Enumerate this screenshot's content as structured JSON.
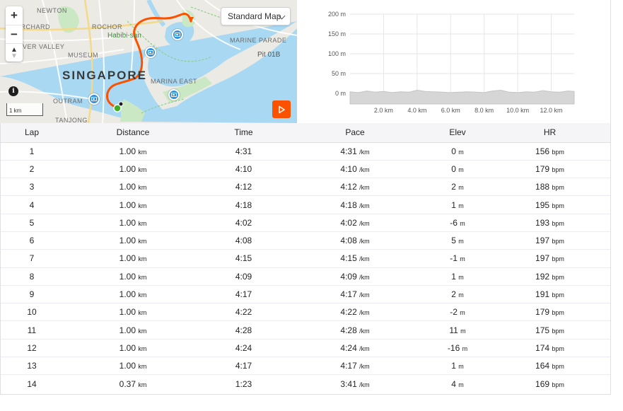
{
  "map": {
    "style_selector": "Standard Map",
    "zoom_in": "+",
    "zoom_out": "−",
    "scale_label": "1 km",
    "info": "i",
    "labels": {
      "newton": "NEWTON",
      "orchard": "ORCHARD",
      "rochor": "ROCHOR",
      "river_valley": "RIVER VALLEY",
      "museum": "MUSEUM",
      "singapore": "SINGAPORE",
      "habibi": "Habibi-san",
      "marine_parade": "MARINE PARADE",
      "pit": "Pit 01B",
      "marina_east": "MARINA EAST",
      "outram": "OUTRAM",
      "tanjong": "TANJONG"
    },
    "colors": {
      "route": "#fc5200",
      "water": "#a9d8f2",
      "park": "#c9e8c3",
      "start": "#3fae22",
      "photo": "#2f8fe0"
    }
  },
  "chart_data": {
    "type": "area",
    "title": "",
    "xlabel": "",
    "ylabel": "",
    "x_unit": "km",
    "y_unit": "m",
    "xlim": [
      0,
      13.37
    ],
    "ylim": [
      0,
      200
    ],
    "x_ticks": [
      "2.0 km",
      "4.0 km",
      "6.0 km",
      "8.0 km",
      "10.0 km",
      "12.0 km"
    ],
    "y_ticks": [
      "200 m",
      "150 m",
      "100 m",
      "50 m",
      "0 m"
    ],
    "grid": true,
    "x": [
      0,
      0.5,
      1.0,
      1.5,
      2.0,
      2.5,
      3.0,
      3.5,
      4.0,
      4.5,
      5.0,
      5.5,
      6.0,
      6.5,
      7.0,
      7.5,
      8.0,
      8.5,
      9.0,
      9.5,
      10.0,
      10.5,
      11.0,
      11.5,
      12.0,
      12.5,
      13.0,
      13.37
    ],
    "y": [
      4,
      2,
      6,
      3,
      5,
      2,
      4,
      3,
      8,
      5,
      4,
      3,
      2,
      3,
      4,
      3,
      2,
      6,
      8,
      3,
      2,
      4,
      3,
      7,
      4,
      3,
      6,
      5
    ],
    "fill_color": "#d6d6d6"
  },
  "table": {
    "headers": {
      "lap": "Lap",
      "distance": "Distance",
      "time": "Time",
      "pace": "Pace",
      "elev": "Elev",
      "hr": "HR"
    },
    "rows": [
      {
        "lap": "1",
        "distance": "1.00",
        "distance_unit": "km",
        "time": "4:31",
        "pace": "4:31",
        "pace_unit": "/km",
        "elev": "0",
        "elev_unit": "m",
        "hr": "156",
        "hr_unit": "bpm"
      },
      {
        "lap": "2",
        "distance": "1.00",
        "distance_unit": "km",
        "time": "4:10",
        "pace": "4:10",
        "pace_unit": "/km",
        "elev": "0",
        "elev_unit": "m",
        "hr": "179",
        "hr_unit": "bpm"
      },
      {
        "lap": "3",
        "distance": "1.00",
        "distance_unit": "km",
        "time": "4:12",
        "pace": "4:12",
        "pace_unit": "/km",
        "elev": "2",
        "elev_unit": "m",
        "hr": "188",
        "hr_unit": "bpm"
      },
      {
        "lap": "4",
        "distance": "1.00",
        "distance_unit": "km",
        "time": "4:18",
        "pace": "4:18",
        "pace_unit": "/km",
        "elev": "1",
        "elev_unit": "m",
        "hr": "195",
        "hr_unit": "bpm"
      },
      {
        "lap": "5",
        "distance": "1.00",
        "distance_unit": "km",
        "time": "4:02",
        "pace": "4:02",
        "pace_unit": "/km",
        "elev": "-6",
        "elev_unit": "m",
        "hr": "193",
        "hr_unit": "bpm"
      },
      {
        "lap": "6",
        "distance": "1.00",
        "distance_unit": "km",
        "time": "4:08",
        "pace": "4:08",
        "pace_unit": "/km",
        "elev": "5",
        "elev_unit": "m",
        "hr": "197",
        "hr_unit": "bpm"
      },
      {
        "lap": "7",
        "distance": "1.00",
        "distance_unit": "km",
        "time": "4:15",
        "pace": "4:15",
        "pace_unit": "/km",
        "elev": "-1",
        "elev_unit": "m",
        "hr": "197",
        "hr_unit": "bpm"
      },
      {
        "lap": "8",
        "distance": "1.00",
        "distance_unit": "km",
        "time": "4:09",
        "pace": "4:09",
        "pace_unit": "/km",
        "elev": "1",
        "elev_unit": "m",
        "hr": "192",
        "hr_unit": "bpm"
      },
      {
        "lap": "9",
        "distance": "1.00",
        "distance_unit": "km",
        "time": "4:17",
        "pace": "4:17",
        "pace_unit": "/km",
        "elev": "2",
        "elev_unit": "m",
        "hr": "191",
        "hr_unit": "bpm"
      },
      {
        "lap": "10",
        "distance": "1.00",
        "distance_unit": "km",
        "time": "4:22",
        "pace": "4:22",
        "pace_unit": "/km",
        "elev": "-2",
        "elev_unit": "m",
        "hr": "179",
        "hr_unit": "bpm"
      },
      {
        "lap": "11",
        "distance": "1.00",
        "distance_unit": "km",
        "time": "4:28",
        "pace": "4:28",
        "pace_unit": "/km",
        "elev": "11",
        "elev_unit": "m",
        "hr": "175",
        "hr_unit": "bpm"
      },
      {
        "lap": "12",
        "distance": "1.00",
        "distance_unit": "km",
        "time": "4:24",
        "pace": "4:24",
        "pace_unit": "/km",
        "elev": "-16",
        "elev_unit": "m",
        "hr": "174",
        "hr_unit": "bpm"
      },
      {
        "lap": "13",
        "distance": "1.00",
        "distance_unit": "km",
        "time": "4:17",
        "pace": "4:17",
        "pace_unit": "/km",
        "elev": "1",
        "elev_unit": "m",
        "hr": "164",
        "hr_unit": "bpm"
      },
      {
        "lap": "14",
        "distance": "0.37",
        "distance_unit": "km",
        "time": "1:23",
        "pace": "3:41",
        "pace_unit": "/km",
        "elev": "4",
        "elev_unit": "m",
        "hr": "169",
        "hr_unit": "bpm"
      }
    ]
  }
}
